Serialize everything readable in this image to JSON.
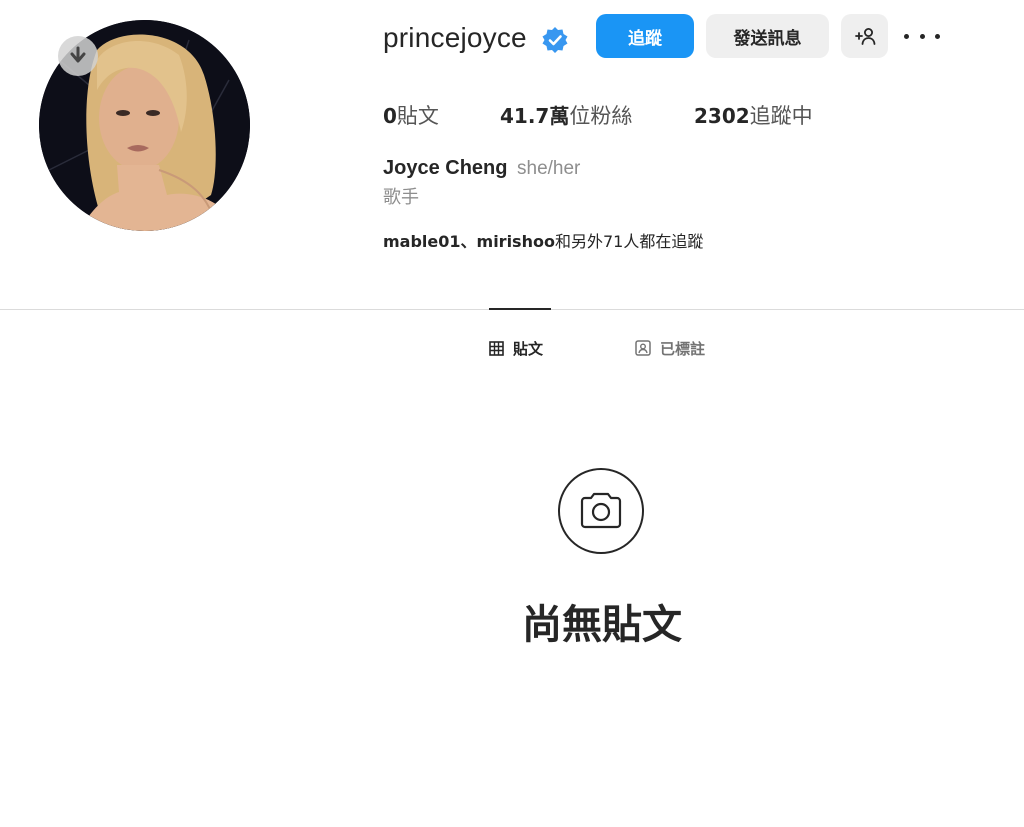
{
  "profile": {
    "username": "princejoyce",
    "verified": true,
    "full_name": "Joyce Cheng",
    "pronouns": "she/her",
    "category": "歌手",
    "avatar_description": "profile-photo"
  },
  "actions": {
    "follow_label": "追蹤",
    "message_label": "發送訊息",
    "suggest_icon": "add-person-icon",
    "more_icon": "more-options-icon"
  },
  "stats": {
    "posts_count": "0",
    "posts_label": "貼文",
    "followers_count": "41.7萬",
    "followers_label": "位粉絲",
    "following_count": "2302",
    "following_label": "追蹤中"
  },
  "followed_by": {
    "users": "mable01、mirishoo",
    "suffix": "和另外71人都在追蹤"
  },
  "tabs": [
    {
      "label": "貼文",
      "icon": "grid-icon",
      "active": true
    },
    {
      "label": "已標註",
      "icon": "tagged-icon",
      "active": false
    }
  ],
  "empty_state": {
    "icon": "camera-icon",
    "title": "尚無貼文"
  },
  "colors": {
    "accent": "#1a95f5",
    "verified_badge": "#3897f0",
    "button_secondary": "#efefef"
  }
}
